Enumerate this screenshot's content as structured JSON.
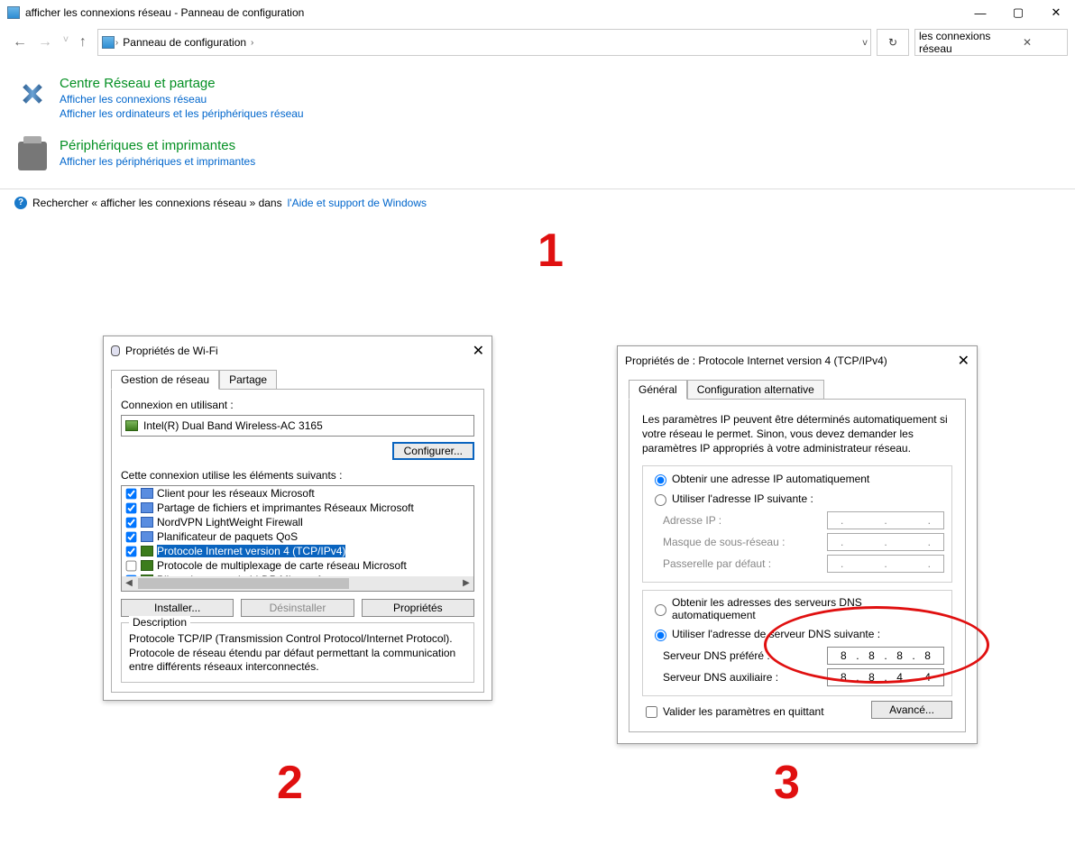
{
  "window": {
    "title": "afficher les connexions réseau - Panneau de configuration",
    "breadcrumb": "Panneau de configuration",
    "search_value": "les connexions réseau"
  },
  "results": {
    "network": {
      "title": "Centre Réseau et partage",
      "link1": "Afficher les connexions réseau",
      "link2": "Afficher les ordinateurs et les périphériques réseau"
    },
    "devices": {
      "title": "Périphériques et imprimantes",
      "link1": "Afficher les périphériques et imprimantes"
    },
    "help_before": "Rechercher « afficher les connexions réseau » dans ",
    "help_link": "l'Aide et support de Windows"
  },
  "steps": {
    "n1": "1",
    "n2": "2",
    "n3": "3"
  },
  "dialog2": {
    "title": "Propriétés de Wi-Fi",
    "tab1": "Gestion de réseau",
    "tab2": "Partage",
    "conn_label": "Connexion en utilisant :",
    "adapter": "Intel(R) Dual Band Wireless-AC 3165",
    "configure": "Configurer...",
    "uses_label": "Cette connexion utilise les éléments suivants :",
    "items": [
      {
        "checked": true,
        "label": "Client pour les réseaux Microsoft"
      },
      {
        "checked": true,
        "label": "Partage de fichiers et imprimantes Réseaux Microsoft"
      },
      {
        "checked": true,
        "label": "NordVPN LightWeight Firewall"
      },
      {
        "checked": true,
        "label": "Planificateur de paquets QoS"
      },
      {
        "checked": true,
        "label": "Protocole Internet version 4 (TCP/IPv4)",
        "selected": true
      },
      {
        "checked": false,
        "label": "Protocole de multiplexage de carte réseau Microsoft"
      },
      {
        "checked": true,
        "label": "Pilote de protocole LLDP Microsoft"
      }
    ],
    "install": "Installer...",
    "uninstall": "Désinstaller",
    "properties": "Propriétés",
    "desc_legend": "Description",
    "desc_text": "Protocole TCP/IP (Transmission Control Protocol/Internet Protocol). Protocole de réseau étendu par défaut permettant la communication entre différents réseaux interconnectés."
  },
  "dialog3": {
    "title": "Propriétés de : Protocole Internet version 4 (TCP/IPv4)",
    "tab1": "Général",
    "tab2": "Configuration alternative",
    "para": "Les paramètres IP peuvent être déterminés automatiquement si votre réseau le permet. Sinon, vous devez demander les paramètres IP appropriés à votre administrateur réseau.",
    "ip_auto": "Obtenir une adresse IP automatiquement",
    "ip_manual": "Utiliser l'adresse IP suivante :",
    "ip_addr": "Adresse IP :",
    "subnet": "Masque de sous-réseau :",
    "gateway": "Passerelle par défaut :",
    "dns_auto": "Obtenir les adresses des serveurs DNS automatiquement",
    "dns_manual": "Utiliser l'adresse de serveur DNS suivante :",
    "dns_pref": "Serveur DNS préféré :",
    "dns_alt": "Serveur DNS auxiliaire :",
    "dns_pref_val": [
      "8",
      "8",
      "8",
      "8"
    ],
    "dns_alt_val": [
      "8",
      "8",
      "4",
      "4"
    ],
    "validate": "Valider les paramètres en quittant",
    "advanced": "Avancé..."
  }
}
